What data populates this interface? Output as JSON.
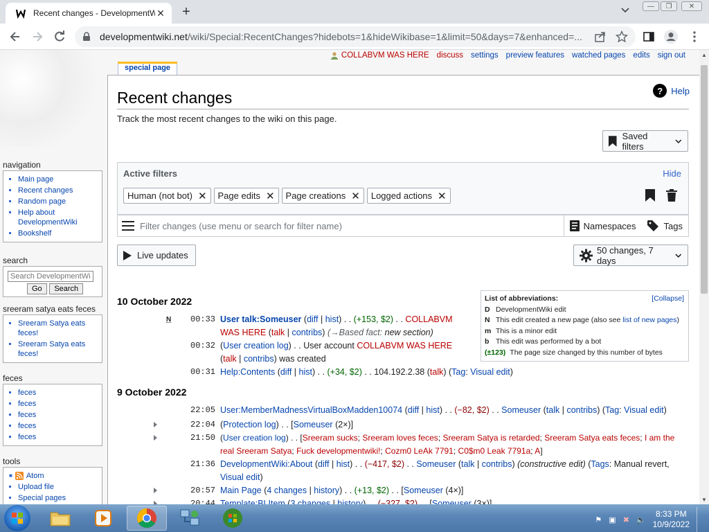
{
  "browser": {
    "tab_title": "Recent changes - DevelopmentWiki",
    "url_host": "developmentwiki.net",
    "url_path": "/wiki/Special:RecentChanges?hidebots=1&hideWikibase=1&limit=50&days=7&enhanced=..."
  },
  "personal": {
    "user": "COLLABVM WAS HERE",
    "links": [
      "discuss",
      "settings",
      "preview features",
      "watched pages",
      "edits",
      "sign out"
    ]
  },
  "sidebar": {
    "navigation": {
      "title": "navigation",
      "items": [
        "Main page",
        "Recent changes",
        "Random page",
        "Help about DevelopmentWiki",
        "Bookshelf"
      ]
    },
    "search": {
      "title": "search",
      "placeholder": "Search DevelopmentWiki",
      "go": "Go",
      "search": "Search"
    },
    "custom1": {
      "title": "sreeram satya eats feces",
      "items": [
        "Sreeram Satya eats feces!",
        "Sreeram Satya eats feces!"
      ]
    },
    "custom2": {
      "title": "feces",
      "items": [
        "feces",
        "feces",
        "feces",
        "feces",
        "feces"
      ]
    },
    "tools": {
      "title": "tools",
      "items": [
        "Atom",
        "Upload file",
        "Special pages"
      ]
    }
  },
  "content": {
    "tab": "special page",
    "title": "Recent changes",
    "help": "Help",
    "tagline": "Track the most recent changes to the wiki on this page.",
    "saved_filters": "Saved filters",
    "active_filters_label": "Active filters",
    "hide": "Hide",
    "chips": [
      "Human (not bot)",
      "Page edits",
      "Page creations",
      "Logged actions"
    ],
    "filter_placeholder": "Filter changes (use menu or search for filter name)",
    "namespaces": "Namespaces",
    "tags": "Tags",
    "live_updates": "Live updates",
    "changes_summary": "50 changes, 7 days"
  },
  "legend": {
    "title": "List of abbreviations:",
    "collapse": "[Collapse]",
    "items": [
      {
        "key": "D",
        "text": "DevelopmentWiki edit"
      },
      {
        "key": "N",
        "text": "This edit created a new page (also see ",
        "link": "list of new pages",
        "after": ")"
      },
      {
        "key": "m",
        "text": "This is a minor edit"
      },
      {
        "key": "b",
        "text": "This edit was performed by a bot"
      },
      {
        "key": "(±123)",
        "text": "The page size changed by this number of bytes"
      }
    ]
  },
  "days": [
    {
      "date": "10 October 2022"
    },
    {
      "date": "9 October 2022"
    }
  ],
  "taskbar": {
    "time": "8:33 PM",
    "date": "10/9/2022"
  }
}
